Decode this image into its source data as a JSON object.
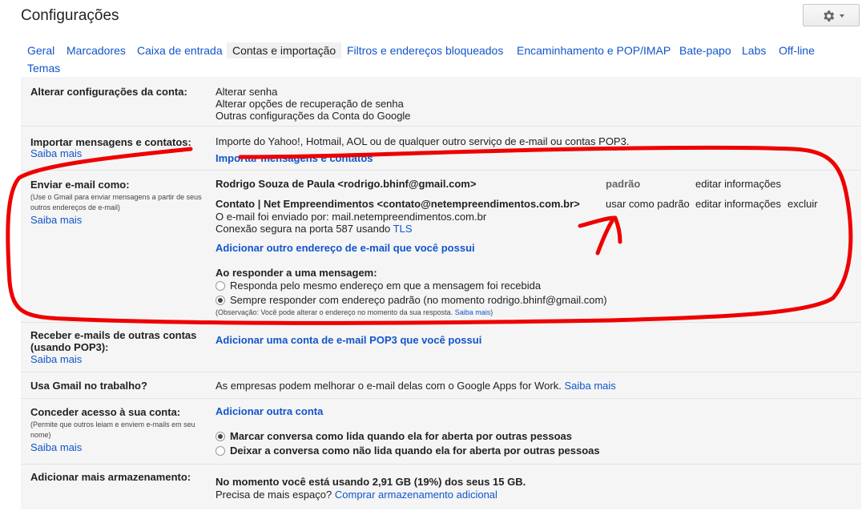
{
  "header": {
    "title": "Configurações"
  },
  "tabs": [
    {
      "label": "Geral"
    },
    {
      "label": "Marcadores"
    },
    {
      "label": "Caixa de entrada"
    },
    {
      "label": "Contas e importação"
    },
    {
      "label": "Filtros e endereços bloqueados"
    },
    {
      "label": "Encaminhamento e POP/IMAP"
    },
    {
      "label": "Bate-papo"
    },
    {
      "label": "Labs"
    },
    {
      "label": "Off-line"
    },
    {
      "label": "Temas"
    }
  ],
  "sections": {
    "account": {
      "label": "Alterar configurações da conta:",
      "links": [
        "Alterar senha",
        "Alterar opções de recuperação de senha",
        "Outras configurações da Conta do Google"
      ]
    },
    "import": {
      "label": "Importar mensagens e contatos:",
      "learn_more": "Saiba mais",
      "description": "Importe do Yahoo!, Hotmail, AOL ou de qualquer outro serviço de e-mail ou contas POP3.",
      "action": "Importar mensagens e contatos"
    },
    "send_as": {
      "label": "Enviar e-mail como:",
      "sublabel": "(Use o Gmail para enviar mensagens a partir de seus outros endereços de e-mail)",
      "learn_more": "Saiba mais",
      "addr1": "Rodrigo Souza de Paula <rodrigo.bhinf@gmail.com>",
      "addr1_default": "padrão",
      "addr1_edit": "editar informações",
      "addr2": "Contato | Net Empreendimentos <contato@netempreendimentos.com.br>",
      "addr2_line1": "O e-mail foi enviado por: mail.netempreendimentos.com.br",
      "addr2_line2_prefix": "Conexão segura na porta 587 usando ",
      "addr2_line2_link": "TLS",
      "addr2_use_default": "usar como padrão",
      "addr2_edit": "editar informações",
      "addr2_delete": "excluir",
      "add_address": "Adicionar outro endereço de e-mail que você possui",
      "reply_title": "Ao responder a uma mensagem:",
      "reply_opt1": "Responda pelo mesmo endereço em que a mensagem foi recebida",
      "reply_opt2": "Sempre responder com endereço padrão (no momento rodrigo.bhinf@gmail.com)",
      "reply_note": "(Observação: Você pode alterar o endereço no momento da sua resposta.",
      "reply_note_link": "Saiba mais",
      "reply_note_end": ")"
    },
    "pop3": {
      "label_line1": "Receber e-mails de outras contas",
      "label_line2": "(usando POP3):",
      "learn_more": "Saiba mais",
      "action": "Adicionar uma conta de e-mail POP3 que você possui"
    },
    "work": {
      "label": "Usa Gmail no trabalho?",
      "description": "As empresas podem melhorar o e-mail delas com o Google Apps for Work.",
      "learn_more": "Saiba mais"
    },
    "grant": {
      "label": "Conceder acesso à sua conta:",
      "sublabel": "(Permite que outros leiam e enviem e-mails em seu nome)",
      "learn_more": "Saiba mais",
      "action": "Adicionar outra conta",
      "opt1": "Marcar conversa como lida quando ela for aberta por outras pessoas",
      "opt2": "Deixar a conversa como não lida quando ela for aberta por outras pessoas"
    },
    "storage": {
      "label": "Adicionar mais armazenamento:",
      "usage": "No momento você está usando 2,91 GB (19%) dos seus 15 GB.",
      "question": "Precisa de mais espaço?",
      "action": "Comprar armazenamento adicional"
    }
  },
  "colors": {
    "link": "#1155cc",
    "annotation": "#ee0000"
  }
}
